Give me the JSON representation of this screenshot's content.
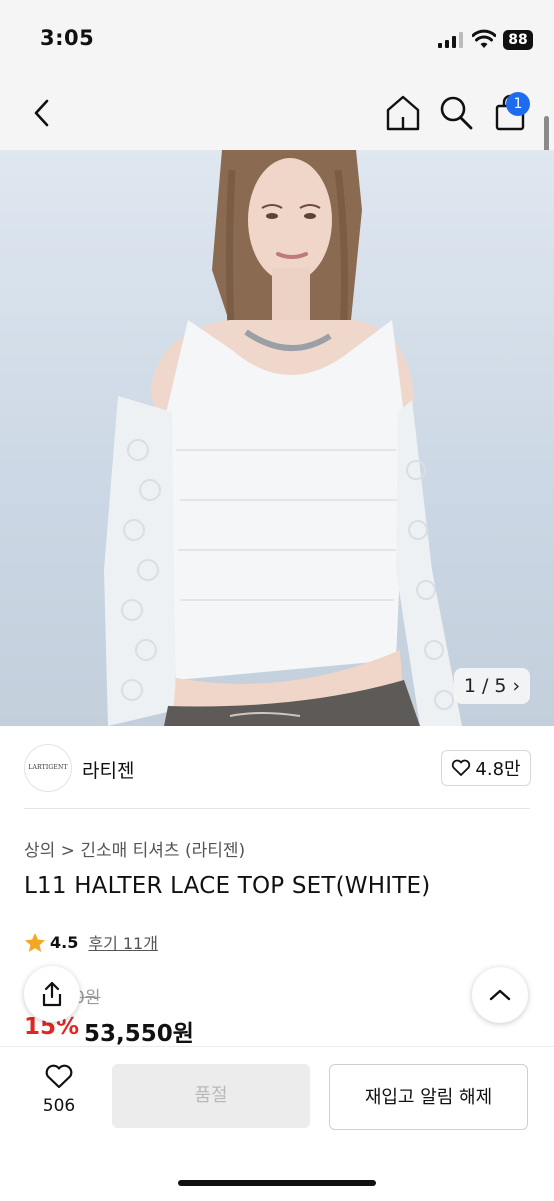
{
  "status_bar": {
    "time": "3:05",
    "battery": "88"
  },
  "header": {
    "cart_count": "1"
  },
  "gallery": {
    "pager": "1 / 5"
  },
  "brand": {
    "logo_text": "LARTIGENT",
    "name": "라티젠",
    "likes": "4.8만"
  },
  "product": {
    "breadcrumb": "상의 > 긴소매 티셔츠 (라티젠)",
    "title": "L11 HALTER LACE TOP SET(WHITE)",
    "rating": "4.5",
    "reviews": "후기 11개",
    "original_price": "0원",
    "discount": "15%",
    "price": "53,550원"
  },
  "bottom_bar": {
    "wish_count": "506",
    "soldout_label": "품절",
    "restock_label": "재입고 알림 해제"
  },
  "colors": {
    "accent": "#1f6bf0",
    "discount": "#e32424",
    "star": "#f5a623"
  }
}
